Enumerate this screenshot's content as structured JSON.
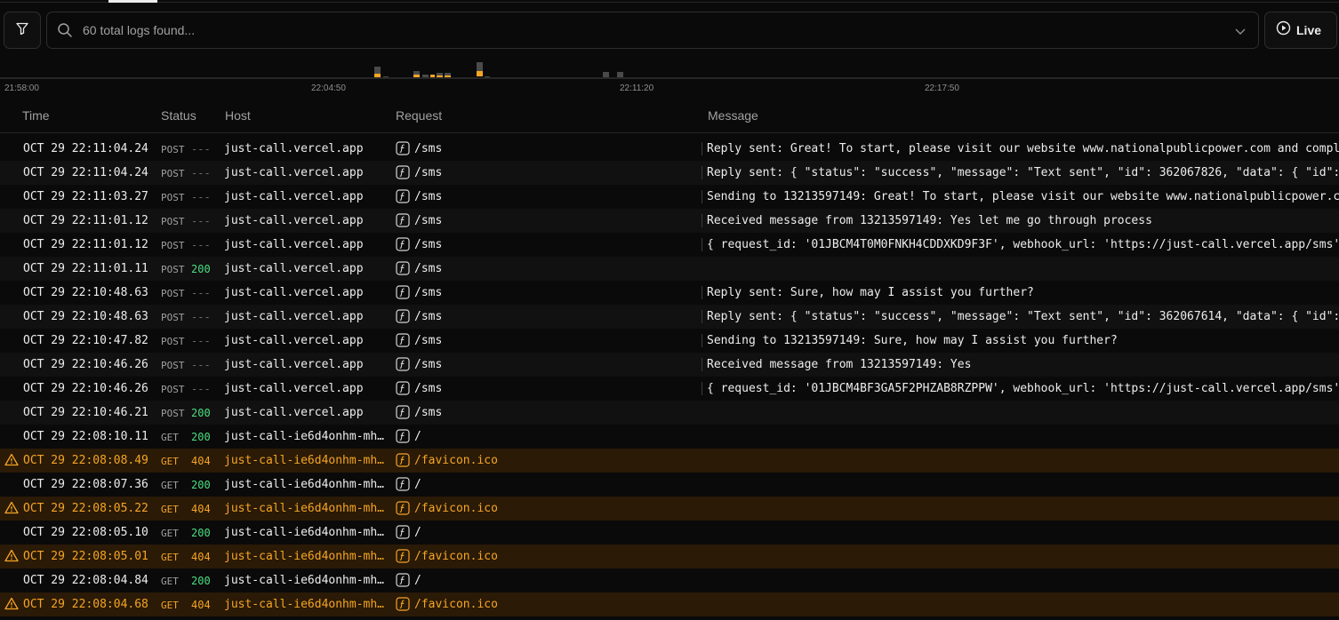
{
  "search": {
    "placeholder": "60 total logs found..."
  },
  "live_button": {
    "label": "Live"
  },
  "timeline": {
    "ticks": [
      "21:58:00",
      "22:04:50",
      "22:11:20",
      "22:17:50"
    ]
  },
  "columns": {
    "time": "Time",
    "status": "Status",
    "host": "Host",
    "request": "Request",
    "message": "Message"
  },
  "colors": {
    "background": "#0a0a0a",
    "warning": "#f5a524",
    "success": "#4ade80",
    "warning_row": "#2a1a06"
  },
  "rows": [
    {
      "time": "OCT 29 22:11:04.24",
      "method": "POST",
      "status": "---",
      "host": "just-call.vercel.app",
      "path": "/sms",
      "message": "Reply sent: Great! To start, please visit our website www.nationalpublicpower.com and compl",
      "level": "info"
    },
    {
      "time": "OCT 29 22:11:04.24",
      "method": "POST",
      "status": "---",
      "host": "just-call.vercel.app",
      "path": "/sms",
      "message": "Reply sent: { \"status\": \"success\", \"message\": \"Text sent\", \"id\": 362067826, \"data\": { \"id\":",
      "level": "info"
    },
    {
      "time": "OCT 29 22:11:03.27",
      "method": "POST",
      "status": "---",
      "host": "just-call.vercel.app",
      "path": "/sms",
      "message": "Sending to 13213597149: Great! To start, please visit our website www.nationalpublicpower.c",
      "level": "info"
    },
    {
      "time": "OCT 29 22:11:01.12",
      "method": "POST",
      "status": "---",
      "host": "just-call.vercel.app",
      "path": "/sms",
      "message": "Received message from 13213597149: Yes let me go through process",
      "level": "info"
    },
    {
      "time": "OCT 29 22:11:01.12",
      "method": "POST",
      "status": "---",
      "host": "just-call.vercel.app",
      "path": "/sms",
      "message": "{ request_id: '01JBCM4T0M0FNKH4CDDXKD9F3F', webhook_url: 'https://just-call.vercel.app/sms'",
      "level": "info"
    },
    {
      "time": "OCT 29 22:11:01.11",
      "method": "POST",
      "status": "200",
      "host": "just-call.vercel.app",
      "path": "/sms",
      "message": "",
      "level": "info"
    },
    {
      "time": "OCT 29 22:10:48.63",
      "method": "POST",
      "status": "---",
      "host": "just-call.vercel.app",
      "path": "/sms",
      "message": "Reply sent: Sure, how may I assist you further?",
      "level": "info"
    },
    {
      "time": "OCT 29 22:10:48.63",
      "method": "POST",
      "status": "---",
      "host": "just-call.vercel.app",
      "path": "/sms",
      "message": "Reply sent: { \"status\": \"success\", \"message\": \"Text sent\", \"id\": 362067614, \"data\": { \"id\":",
      "level": "info"
    },
    {
      "time": "OCT 29 22:10:47.82",
      "method": "POST",
      "status": "---",
      "host": "just-call.vercel.app",
      "path": "/sms",
      "message": "Sending to 13213597149: Sure, how may I assist you further?",
      "level": "info"
    },
    {
      "time": "OCT 29 22:10:46.26",
      "method": "POST",
      "status": "---",
      "host": "just-call.vercel.app",
      "path": "/sms",
      "message": "Received message from 13213597149: Yes",
      "level": "info"
    },
    {
      "time": "OCT 29 22:10:46.26",
      "method": "POST",
      "status": "---",
      "host": "just-call.vercel.app",
      "path": "/sms",
      "message": "{ request_id: '01JBCM4BF3GA5F2PHZAB8RZPPW', webhook_url: 'https://just-call.vercel.app/sms'",
      "level": "info"
    },
    {
      "time": "OCT 29 22:10:46.21",
      "method": "POST",
      "status": "200",
      "host": "just-call.vercel.app",
      "path": "/sms",
      "message": "",
      "level": "info"
    },
    {
      "time": "OCT 29 22:08:10.11",
      "method": "GET",
      "status": "200",
      "host": "just-call-ie6d4onhm-mh…",
      "path": "/",
      "message": "",
      "level": "info"
    },
    {
      "time": "OCT 29 22:08:08.49",
      "method": "GET",
      "status": "404",
      "host": "just-call-ie6d4onhm-mh…",
      "path": "/favicon.ico",
      "message": "",
      "level": "warning"
    },
    {
      "time": "OCT 29 22:08:07.36",
      "method": "GET",
      "status": "200",
      "host": "just-call-ie6d4onhm-mh…",
      "path": "/",
      "message": "",
      "level": "info"
    },
    {
      "time": "OCT 29 22:08:05.22",
      "method": "GET",
      "status": "404",
      "host": "just-call-ie6d4onhm-mh…",
      "path": "/favicon.ico",
      "message": "",
      "level": "warning"
    },
    {
      "time": "OCT 29 22:08:05.10",
      "method": "GET",
      "status": "200",
      "host": "just-call-ie6d4onhm-mh…",
      "path": "/",
      "message": "",
      "level": "info"
    },
    {
      "time": "OCT 29 22:08:05.01",
      "method": "GET",
      "status": "404",
      "host": "just-call-ie6d4onhm-mh…",
      "path": "/favicon.ico",
      "message": "",
      "level": "warning"
    },
    {
      "time": "OCT 29 22:08:04.84",
      "method": "GET",
      "status": "200",
      "host": "just-call-ie6d4onhm-mh…",
      "path": "/",
      "message": "",
      "level": "info"
    },
    {
      "time": "OCT 29 22:08:04.68",
      "method": "GET",
      "status": "404",
      "host": "just-call-ie6d4onhm-mh…",
      "path": "/favicon.ico",
      "message": "",
      "level": "warning"
    }
  ]
}
